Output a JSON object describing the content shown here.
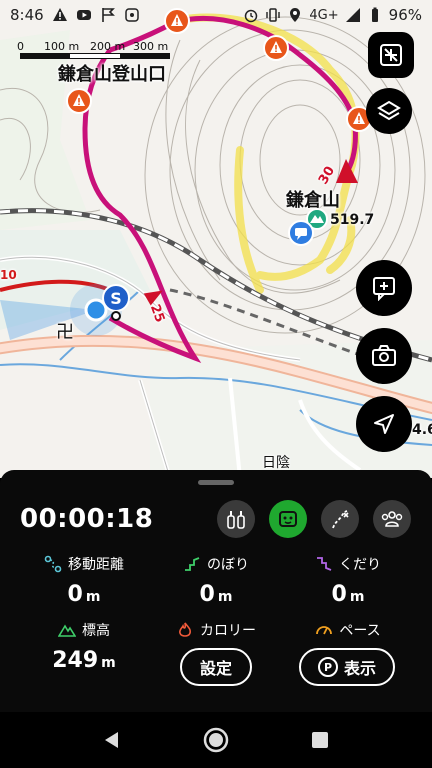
{
  "status_bar": {
    "time": "8:46",
    "network": "4G+",
    "battery": "96%"
  },
  "map": {
    "scale_labels": [
      "0",
      "100 m",
      "200 m",
      "300 m"
    ],
    "trailhead_label": "鎌倉山登山口",
    "peak_name": "鎌倉山",
    "peak_elevation": "519.7",
    "start_marker": "S",
    "direction_time_a": "25",
    "direction_time_b": "30",
    "road_number": "10",
    "place_label": "日陰",
    "edge_value": "4.6"
  },
  "panel": {
    "elapsed_time": "00:00:18",
    "stats": {
      "distance": {
        "label": "移動距離",
        "value": "0",
        "unit": "m"
      },
      "ascent": {
        "label": "のぼり",
        "value": "0",
        "unit": "m"
      },
      "descent": {
        "label": "くだり",
        "value": "0",
        "unit": "m"
      },
      "elevation": {
        "label": "標高",
        "value": "249",
        "unit": "m"
      },
      "calories": {
        "label": "カロリー"
      },
      "pace": {
        "label": "ペース"
      }
    },
    "settings_button": "設定",
    "display_button": "表示",
    "display_badge": "P"
  },
  "colors": {
    "route": "#c8117a",
    "active_mode": "#1fa82f",
    "trail_highlight": "#f3e04a"
  }
}
